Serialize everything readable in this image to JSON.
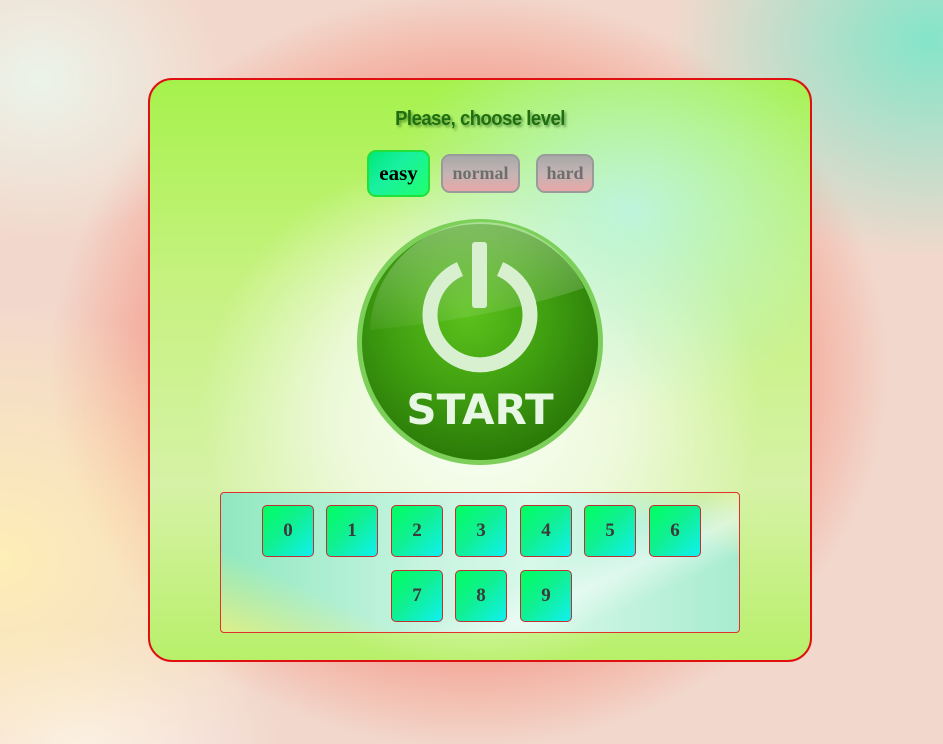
{
  "title": "Please, choose level",
  "levels": [
    {
      "label": "easy",
      "state": "selected"
    },
    {
      "label": "normal",
      "state": "unselected"
    },
    {
      "label": "hard",
      "state": "unselected"
    }
  ],
  "start_button": {
    "label": "START",
    "icon": "power-icon"
  },
  "digits": [
    "0",
    "1",
    "2",
    "3",
    "4",
    "5",
    "6",
    "7",
    "8",
    "9"
  ],
  "colors": {
    "panel_border": "#e01010",
    "start_green": "#3a9a10",
    "selected_level": "#18f0a0"
  }
}
